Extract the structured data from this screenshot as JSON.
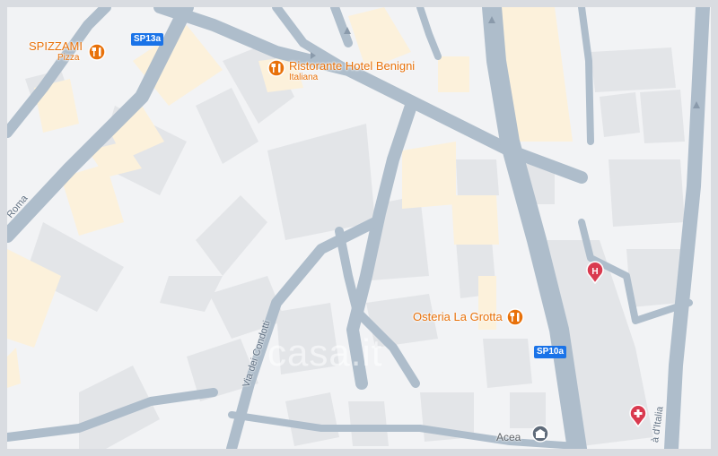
{
  "map": {
    "colors": {
      "road": "#aebdcb",
      "building": "#e3e5e8",
      "highlight_building": "#fcf1db",
      "poi": "#e8710a",
      "shield": "#1a73e8",
      "hospital": "#d93a4f"
    },
    "pois": [
      {
        "name": "SPIZZAMI",
        "sub": "Pizza",
        "icon": "restaurant-icon"
      },
      {
        "name": "Ristorante Hotel Benigni",
        "sub": "Italiana",
        "icon": "restaurant-icon"
      },
      {
        "name": "Osteria La Grotta",
        "sub": "",
        "icon": "restaurant-icon"
      }
    ],
    "road_shields": [
      "SP13a",
      "SP10a"
    ],
    "streets": [
      "Roma",
      "Via dei Condotti",
      "à d'Italia"
    ],
    "places": [
      "Acea"
    ],
    "watermark": "casa.it",
    "markers": [
      "hospital-icon",
      "medical-icon",
      "business-icon"
    ]
  }
}
